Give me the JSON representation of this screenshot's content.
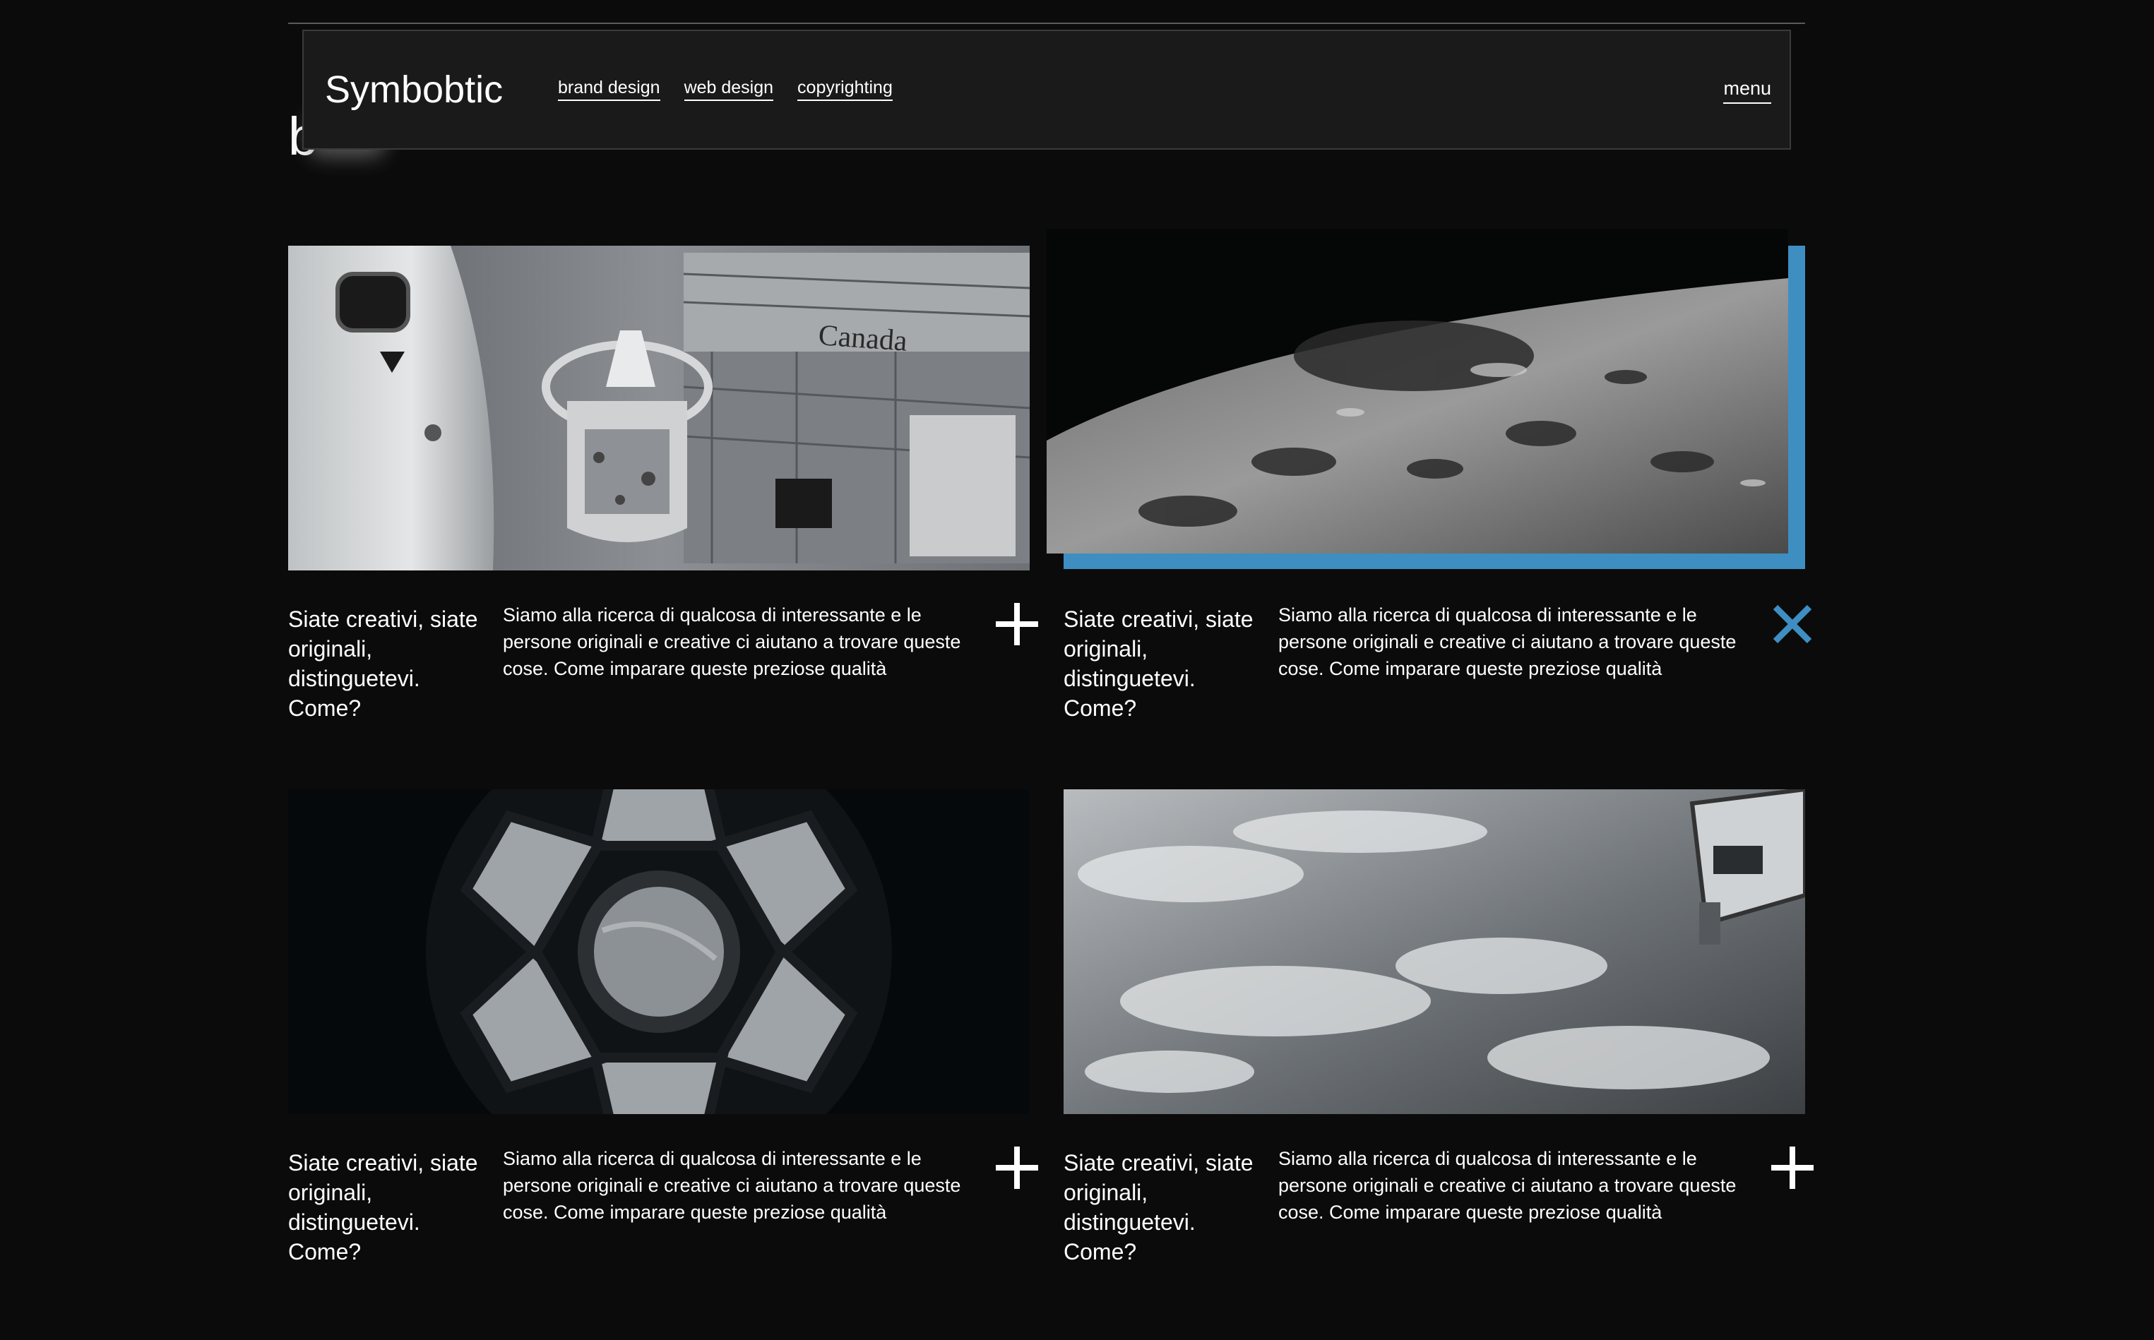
{
  "header": {
    "logo": "Symbobtic",
    "nav": [
      "brand design",
      "web design",
      "copyrighting"
    ],
    "menu_label": "menu"
  },
  "page": {
    "heading_visible": "b"
  },
  "colors": {
    "background": "#0b0b0b",
    "header_bg": "#1a1a1a",
    "accent": "#3e8ec2"
  },
  "cards": [
    {
      "image": "space-shuttle-canada-arm-photo",
      "image_text": "Canada",
      "title": "Siate creativi, siate originali, distinguetevi. Come?",
      "description": "Siamo alla ricerca di qualcosa di interessante e le persone originali e creative ci aiutano a trovare queste cose. Come imparare queste preziose qualità",
      "toggle_icon": "plus-icon",
      "expanded": false
    },
    {
      "image": "moon-surface-craters-photo",
      "title": "Siate creativi, siate originali, distinguetevi. Come?",
      "description": "Siamo alla ricerca di qualcosa di interessante e le persone originali e creative ci aiutano a trovare queste cose. Come imparare queste preziose qualità",
      "toggle_icon": "close-icon",
      "expanded": true
    },
    {
      "image": "iss-cupola-window-photo",
      "title": "Siate creativi, siate originali, distinguetevi. Come?",
      "description": "Siamo alla ricerca di qualcosa di interessante e le persone originali e creative ci aiutano a trovare queste cose. Come imparare queste preziose qualità",
      "toggle_icon": "plus-icon",
      "expanded": false
    },
    {
      "image": "earth-clouds-from-orbit-photo",
      "title": "Siate creativi, siate originali, distinguetevi. Come?",
      "description": "Siamo alla ricerca di qualcosa di interessante e le persone originali e creative ci aiutano a trovare queste cose. Come imparare queste preziose qualità",
      "toggle_icon": "plus-icon",
      "expanded": false
    }
  ]
}
